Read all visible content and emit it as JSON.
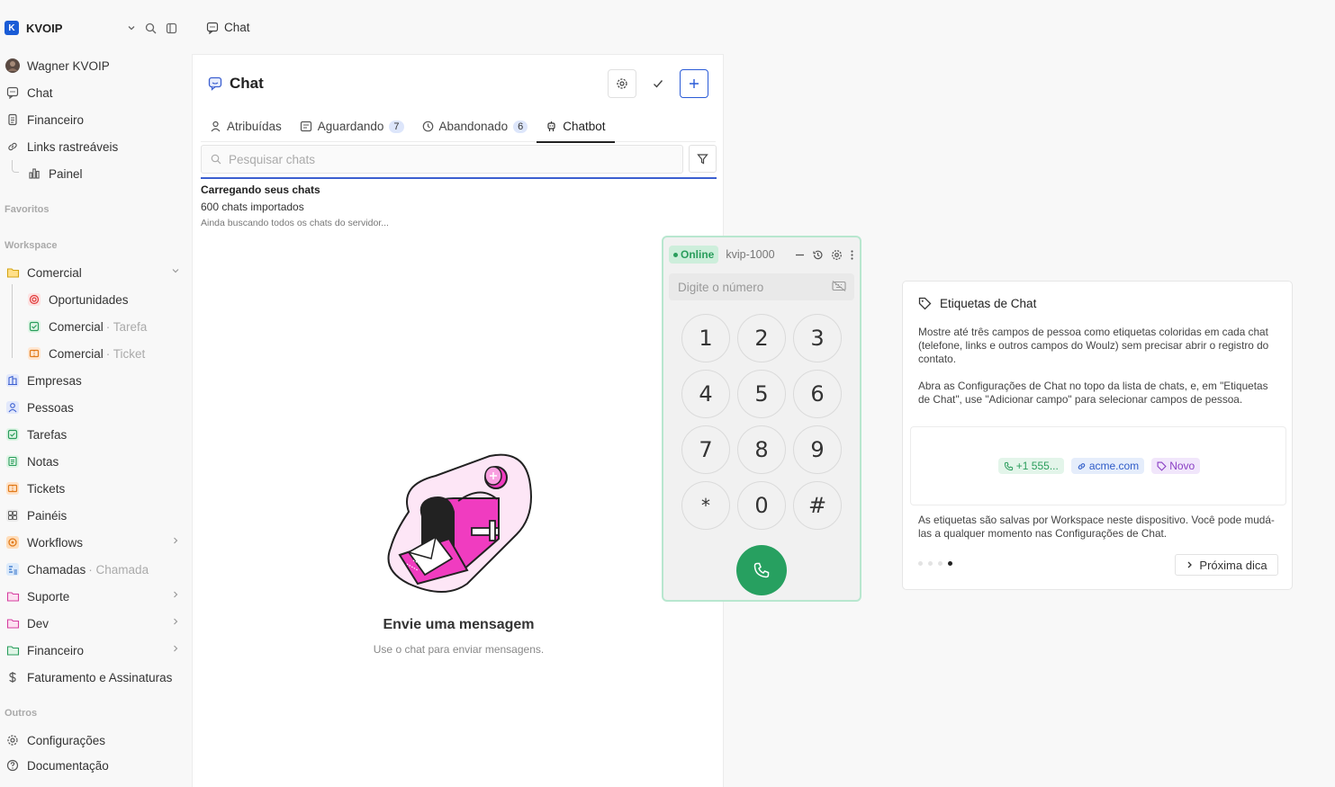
{
  "sidebar": {
    "workspace_name": "KVOIP",
    "logo_text": "K",
    "user_name": "Wagner KVOIP",
    "top_items": [
      {
        "label": "Chat"
      },
      {
        "label": "Financeiro"
      },
      {
        "label": "Links rastreáveis"
      },
      {
        "label": "Painel"
      }
    ],
    "favorites_heading": "Favoritos",
    "workspace_heading": "Workspace",
    "workspace_items": [
      {
        "label": "Comercial"
      },
      {
        "label": "Oportunidades"
      },
      {
        "label": "Comercial",
        "suffix": "· Tarefa"
      },
      {
        "label": "Comercial",
        "suffix": "· Ticket"
      },
      {
        "label": "Empresas"
      },
      {
        "label": "Pessoas"
      },
      {
        "label": "Tarefas"
      },
      {
        "label": "Notas"
      },
      {
        "label": "Tickets"
      },
      {
        "label": "Painéis"
      },
      {
        "label": "Workflows"
      },
      {
        "label": "Chamadas",
        "suffix": "· Chamada"
      },
      {
        "label": "Suporte"
      },
      {
        "label": "Dev"
      },
      {
        "label": "Financeiro"
      },
      {
        "label": "Faturamento e Assinaturas"
      }
    ],
    "others_heading": "Outros",
    "other_items": [
      {
        "label": "Configurações"
      },
      {
        "label": "Documentação"
      }
    ]
  },
  "topbar": {
    "title": "Chat"
  },
  "chat": {
    "title": "Chat",
    "tabs": [
      {
        "label": "Atribuídas"
      },
      {
        "label": "Aguardando",
        "count": "7"
      },
      {
        "label": "Abandonado",
        "count": "6"
      },
      {
        "label": "Chatbot"
      }
    ],
    "search_placeholder": "Pesquisar chats",
    "loading_title": "Carregando seus chats",
    "loading_count": "600 chats importados",
    "loading_sub": "Ainda buscando todos os chats do servidor...",
    "empty_title": "Envie uma mensagem",
    "empty_sub": "Use o chat para enviar mensagens."
  },
  "dialer": {
    "status": "Online",
    "extension": "kvip-1000",
    "input_placeholder": "Digite o número",
    "keys": [
      "1",
      "2",
      "3",
      "4",
      "5",
      "6",
      "7",
      "8",
      "9",
      "*",
      "0",
      "#"
    ]
  },
  "tip": {
    "title": "Etiquetas de Chat",
    "paragraph1": "Mostre até três campos de pessoa como etiquetas coloridas em cada chat (telefone, links e outros campos do Woulz) sem precisar abrir o registro do contato.",
    "paragraph2": "Abra as Configurações de Chat no topo da lista de chats, e, em \"Etiquetas de Chat\", use \"Adicionar campo\" para selecionar campos de pessoa.",
    "pill_phone": "+1 555...",
    "pill_link": "acme.com",
    "pill_tag": "Novo",
    "paragraph3": "As etiquetas são salvas por Workspace neste dispositivo. Você pode mudá-las a qualquer momento nas Configurações de Chat.",
    "next_label": "Próxima dica",
    "page_count": 4,
    "current_page": 4
  },
  "colors": {
    "accent": "#2a5bd7",
    "online": "#2a9d5c",
    "call": "#27a060",
    "illustration_pink": "#f03cc0"
  }
}
